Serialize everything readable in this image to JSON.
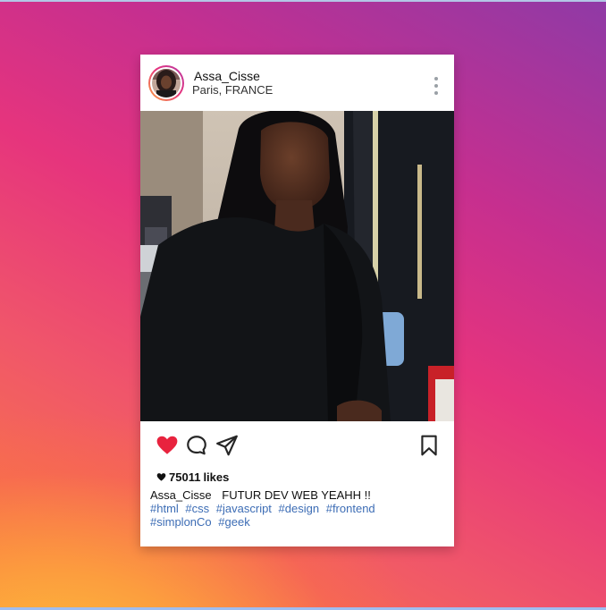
{
  "post": {
    "username": "Assa_Cisse",
    "location": "Paris, FRANCE",
    "likes_count": "75011",
    "likes_word": "likes",
    "caption_user": "Assa_Cisse",
    "caption_text": "FUTUR DEV WEB YEAHH !!",
    "hashtags": [
      "#html",
      "#css",
      "#javascript",
      "#design",
      "#frontend",
      "#simplonCo",
      "#geek"
    ]
  },
  "icons": {
    "more": "vertical-ellipsis-icon",
    "like": "heart-filled-icon",
    "comment": "comment-bubble-icon",
    "share": "paper-plane-icon",
    "save": "bookmark-icon",
    "likes_heart": "small-heart-icon"
  },
  "colors": {
    "like_red": "#e8233e",
    "hashtag_blue": "#3d6db5",
    "card_bg": "#ffffff"
  }
}
